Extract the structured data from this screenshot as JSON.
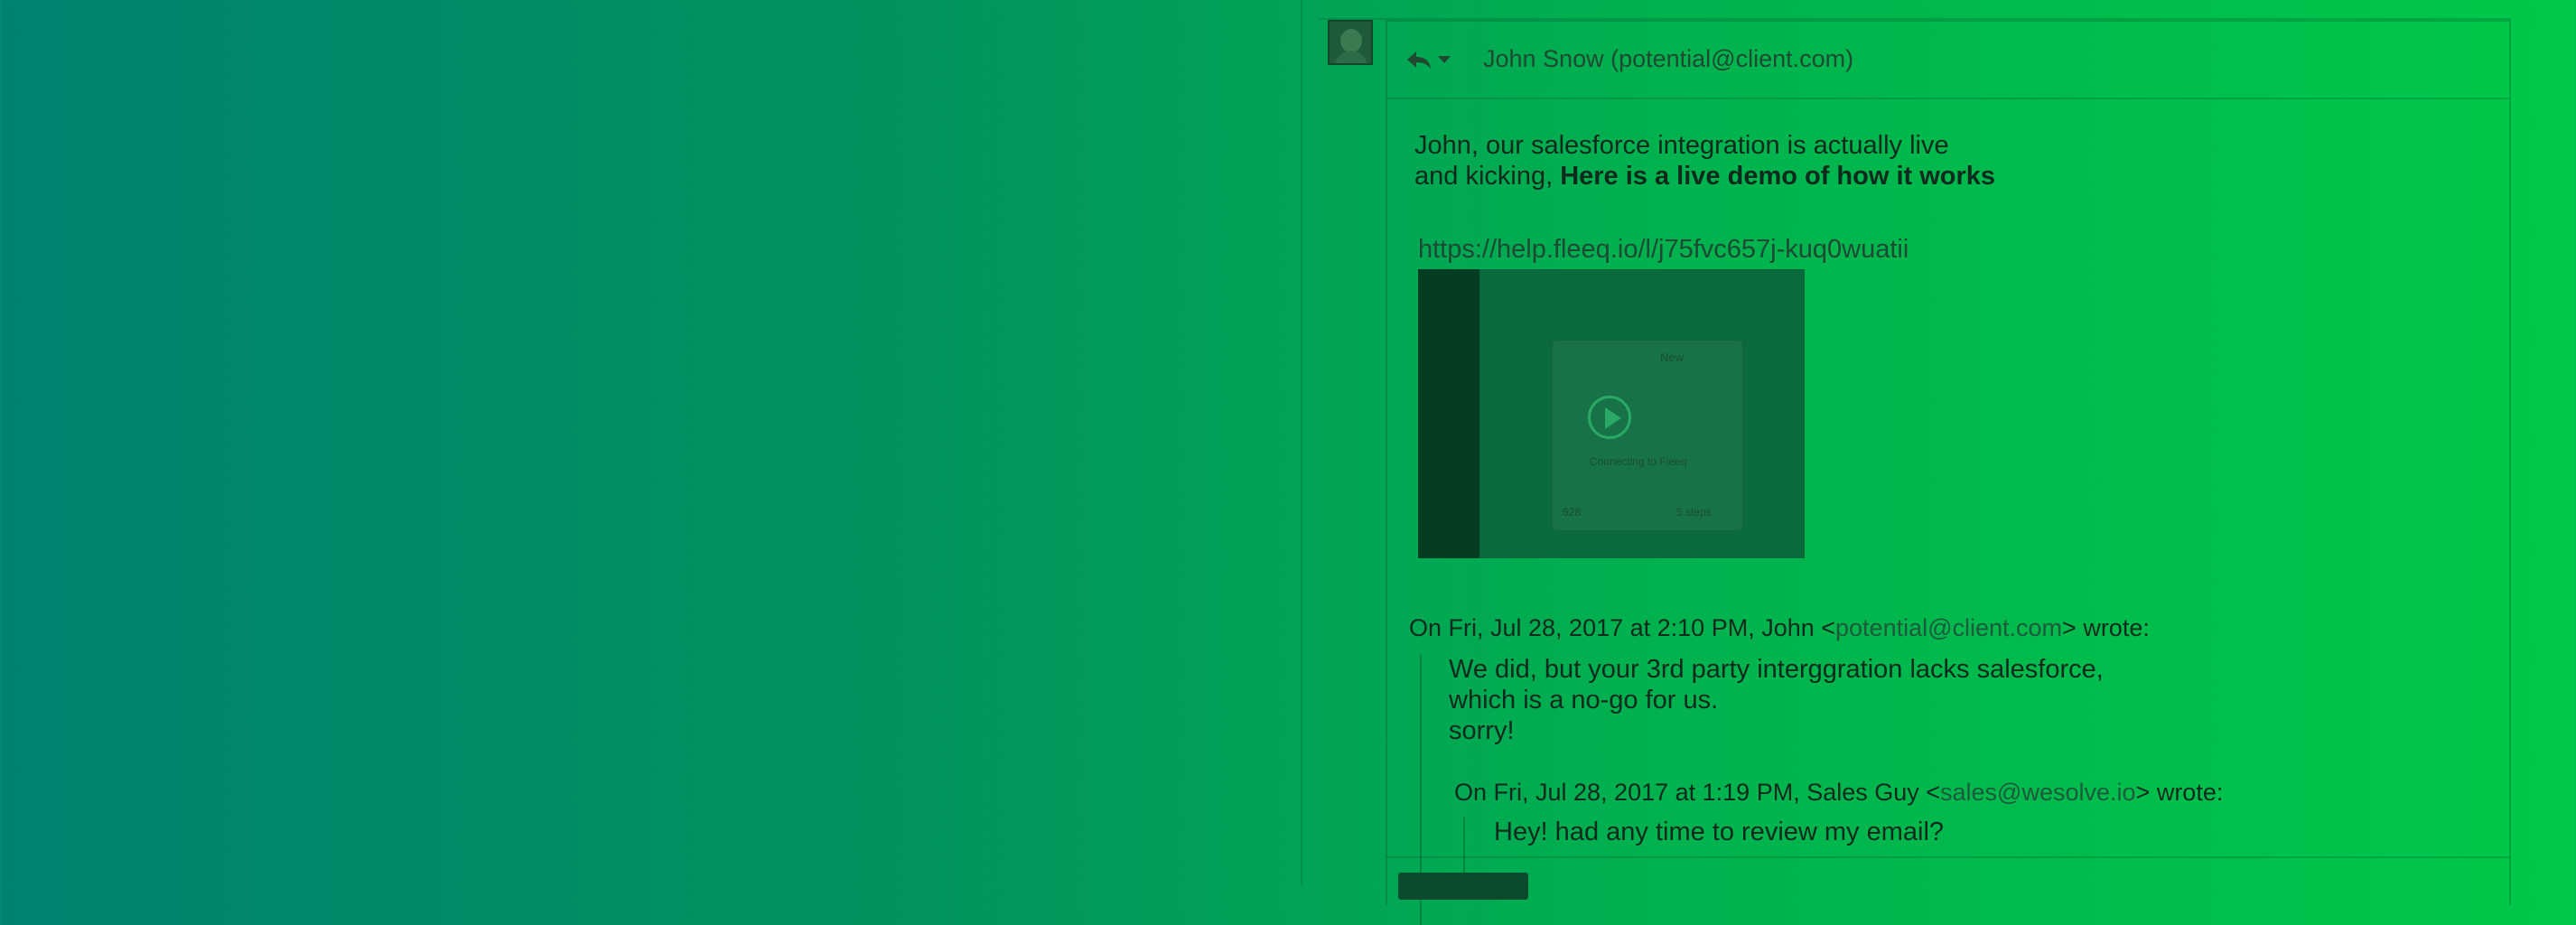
{
  "email": {
    "header": {
      "to": "John Snow (potential@client.com)"
    },
    "body": {
      "line1": "John, our salesforce integration is actually live",
      "line2_prefix": "and kicking, ",
      "line2_bold": "Here is a live demo of how it works",
      "link": "https://help.fleeq.io/l/j75fvc657j-kuq0wuatii"
    },
    "video": {
      "badge": "New",
      "caption": "Connecting to Fleeq",
      "left_meta": "628",
      "right_meta": "5 steps"
    },
    "quote1": {
      "head_prefix": "On Fri, Jul 28, 2017 at 2:10 PM, John <",
      "head_email": "potential@client.com",
      "head_suffix": "> wrote:",
      "lines": [
        "We did, but your 3rd party interggration lacks salesforce,",
        "which is a no-go for us.",
        "sorry!"
      ]
    },
    "quote2": {
      "head_prefix": "On Fri, Jul 28, 2017 at 1:19 PM, Sales Guy <",
      "head_email": "sales@wesolve.io",
      "head_suffix": "> wrote:",
      "line": "Hey! had any time to review my email?"
    }
  },
  "icons": {
    "reply": "reply-icon",
    "caret": "chevron-down-icon",
    "play": "play-icon",
    "avatar": "avatar"
  },
  "colors": {
    "bg_left": "#018270",
    "bg_right": "#00c84a"
  }
}
